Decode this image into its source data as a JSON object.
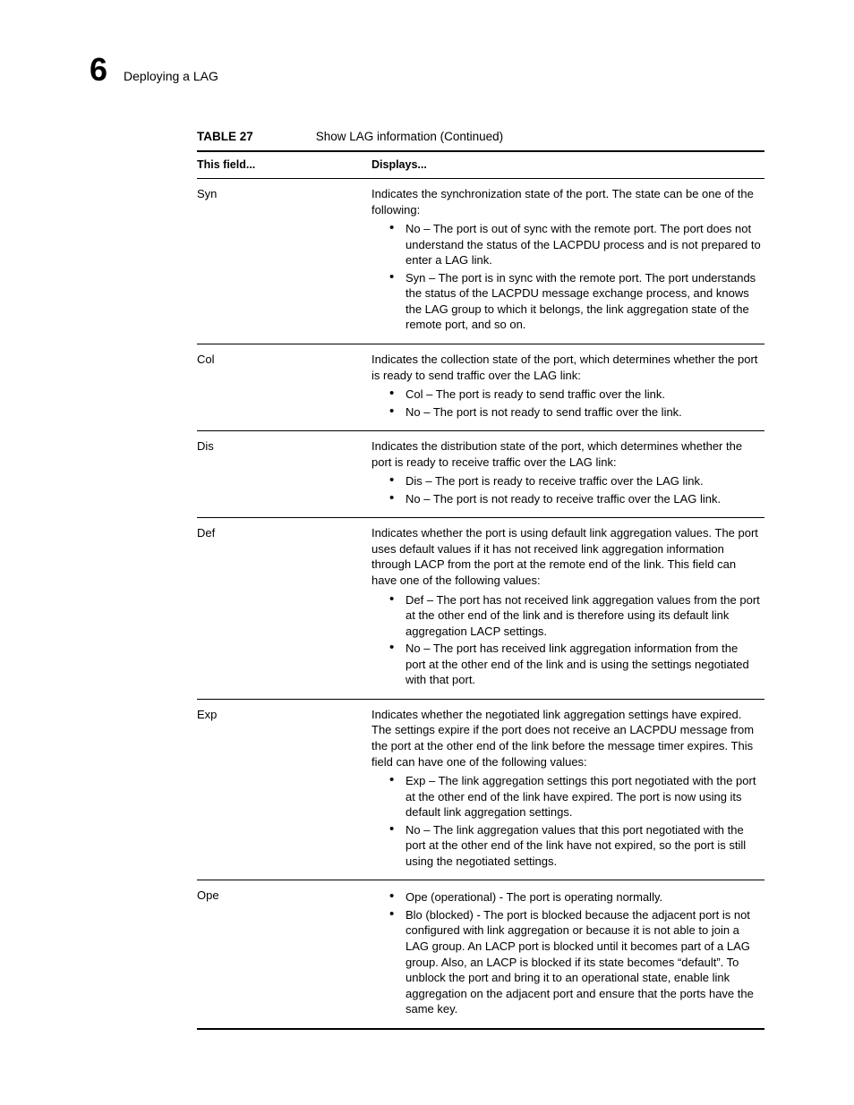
{
  "header": {
    "chapter_number": "6",
    "chapter_title": "Deploying a LAG"
  },
  "table": {
    "label": "TABLE 27",
    "title": "Show LAG information  (Continued)",
    "head_field": "This field...",
    "head_displays": "Displays...",
    "rows": [
      {
        "field": "Syn",
        "intro": "Indicates the synchronization state of the port. The state can be one of the following:",
        "bullets": [
          "No – The port is out of sync with the remote port. The port does not understand the status of the LACPDU process and is not prepared to enter a LAG link.",
          "Syn – The port is in sync with the remote port. The port understands the status of the LACPDU message exchange process, and knows the LAG group to which it belongs, the link aggregation state of the remote port, and so on."
        ]
      },
      {
        "field": "Col",
        "intro": "Indicates the collection state of the port, which determines whether the port is ready to send traffic over the LAG link:",
        "bullets": [
          "Col – The port is ready to send traffic over the link.",
          "No – The port is not ready to send traffic over the link."
        ]
      },
      {
        "field": "Dis",
        "intro": "Indicates the distribution state of the port, which determines whether the port is ready to receive traffic over the LAG link:",
        "bullets": [
          "Dis – The port is ready to receive traffic over the LAG link.",
          "No – The port is not ready to receive traffic over the LAG link."
        ]
      },
      {
        "field": "Def",
        "intro": "Indicates whether the port is using default link aggregation values. The port uses default values if it has not received link aggregation information through LACP from the port at the remote end of the link. This field can have one of the following values:",
        "bullets": [
          "Def – The port has not received link aggregation values from the port at the other end of the link and is therefore using its default link aggregation LACP settings.",
          "No – The port has received link aggregation information from the port at the other end of the link and is using the settings negotiated with that port."
        ]
      },
      {
        "field": "Exp",
        "intro": "Indicates whether the negotiated link aggregation settings have expired. The settings expire if the port does not receive an LACPDU message from the port at the other end of the link before the message timer expires. This field can have one of the following values:",
        "bullets": [
          "Exp – The link aggregation settings this port negotiated with the port at the other end of the link have expired. The port is now using its default link aggregation settings.",
          "No – The link aggregation values that this port negotiated with the port at the other end of the link have not expired, so the port is still using the negotiated settings."
        ]
      },
      {
        "field": "Ope",
        "intro": "",
        "bullets": [
          "Ope (operational) - The port is operating normally.",
          "Blo (blocked) - The port is blocked because the adjacent port is not configured with link aggregation or because it is not able to join a LAG group. An LACP port is blocked until it becomes part of a LAG group. Also, an LACP is blocked if its state becomes “default”. To unblock the port and bring it to an operational state, enable link aggregation on the adjacent port and ensure that the ports have the same key."
        ]
      }
    ]
  }
}
